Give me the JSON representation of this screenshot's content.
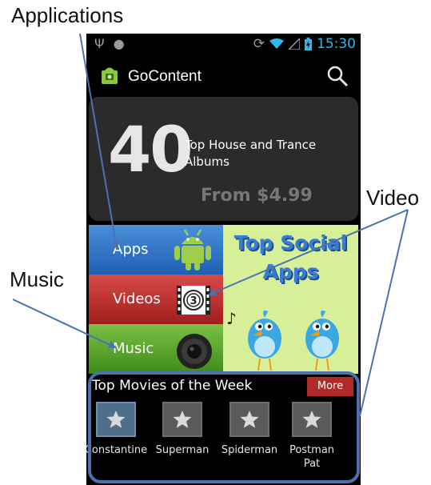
{
  "callouts": {
    "applications": "Applications",
    "music": "Music",
    "video": "Video"
  },
  "status_bar": {
    "time": "15:30",
    "icons": [
      "usb-icon",
      "android-debug-icon",
      "sync-icon",
      "wifi-icon",
      "signal-icon",
      "battery-icon"
    ]
  },
  "action_bar": {
    "app_name": "GoContent",
    "icons": [
      "app-logo-icon",
      "search-icon"
    ]
  },
  "banner": {
    "number": "40",
    "headline": "Top House and Trance Albums",
    "price": "From $4.99"
  },
  "tiles": {
    "apps": "Apps",
    "videos": "Videos",
    "music": "Music"
  },
  "promo": {
    "line1": "Top Social",
    "line2": "Apps"
  },
  "movies": {
    "title": "Top Movies of the Week",
    "more_label": "More",
    "items": [
      {
        "name": "Constantine"
      },
      {
        "name": "Superman"
      },
      {
        "name": "Spiderman"
      },
      {
        "name": "Postman Pat"
      }
    ]
  },
  "colors": {
    "accent": "#33b5e5",
    "apps_tile": "#2f74c8",
    "videos_tile": "#c23333",
    "music_tile": "#5aa62e",
    "more_button": "#b02a2a",
    "promo_background": "#d8ef9a",
    "annotation": "#4a72b0"
  }
}
